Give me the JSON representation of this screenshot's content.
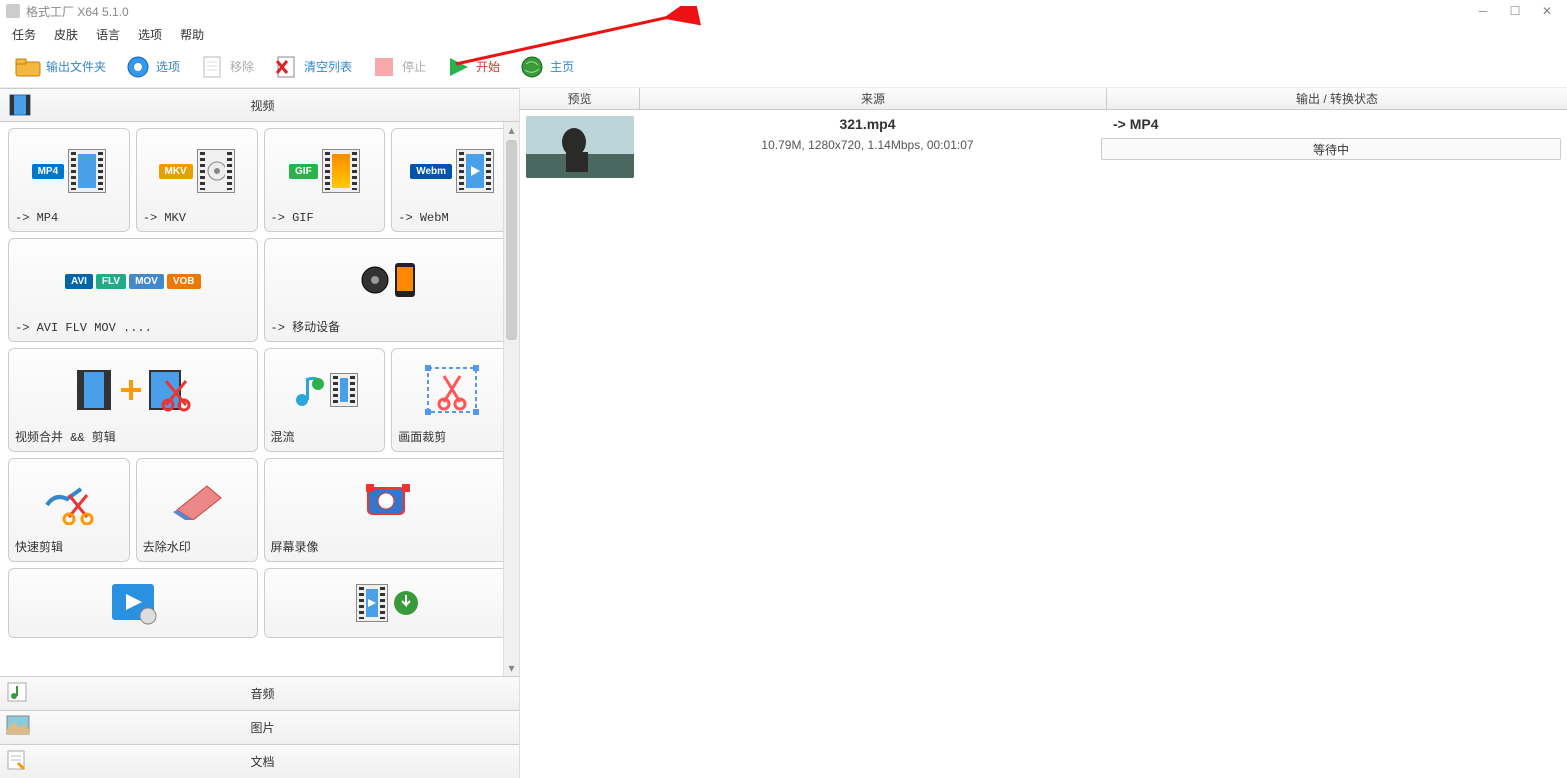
{
  "title": "格式工厂 X64 5.1.0",
  "menu": {
    "task": "任务",
    "skin": "皮肤",
    "language": "语言",
    "options": "选项",
    "help": "帮助"
  },
  "toolbar": {
    "output_folder": "输出文件夹",
    "options": "选项",
    "remove": "移除",
    "clear_list": "清空列表",
    "stop": "停止",
    "start": "开始",
    "home": "主页"
  },
  "sections": {
    "video": "视频",
    "audio": "音频",
    "picture": "图片",
    "document": "文档"
  },
  "tiles": {
    "mp4": "-> MP4",
    "mkv": "-> MKV",
    "gif": "-> GIF",
    "webm": "-> WebM",
    "avi_etc": "-> AVI FLV MOV ....",
    "mobile": "-> 移动设备",
    "merge_edit": "视频合并 && 剪辑",
    "mux": "混流",
    "crop": "画面裁剪",
    "quick_trim": "快速剪辑",
    "remove_wm": "去除水印",
    "screen_rec": "屏幕录像"
  },
  "columns": {
    "preview": "预览",
    "source": "来源",
    "output": "输出 / 转换状态"
  },
  "task": {
    "filename": "321.mp4",
    "meta": "10.79M, 1280x720, 1.14Mbps, 00:01:07",
    "target": "-> MP4",
    "status": "等待中"
  },
  "format_badges": {
    "mp4": "MP4",
    "mkv": "MKV",
    "gif": "GIF",
    "webm": "Webm",
    "avi": "AVI",
    "flv": "FLV",
    "mov": "MOV",
    "vob": "VOB"
  }
}
